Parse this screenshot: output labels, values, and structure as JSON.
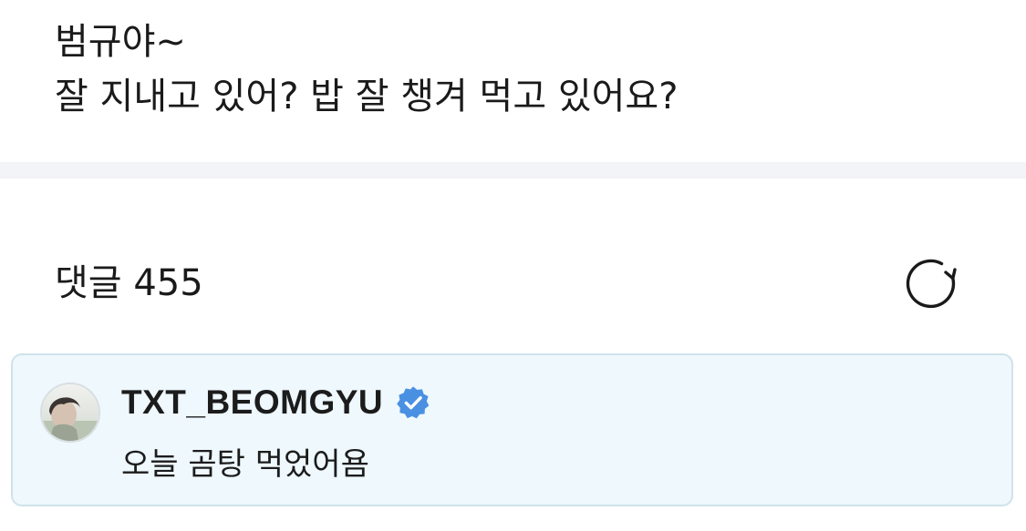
{
  "post": {
    "line1": "범규야~",
    "line2": "잘 지내고 있어? 밥 잘 챙겨 먹고 있어요?"
  },
  "comments": {
    "header_label": "댓글 455",
    "refresh_icon": "refresh-icon",
    "items": [
      {
        "author": "TXT_BEOMGYU",
        "verified": true,
        "verified_icon": "verified-badge-icon",
        "text": "오늘 곰탕 먹었어욤"
      }
    ]
  },
  "colors": {
    "card_background": "#eef8fd",
    "card_border": "#cfe3ea",
    "verified_badge": "#4a90e2",
    "divider": "#f3f4f8"
  }
}
